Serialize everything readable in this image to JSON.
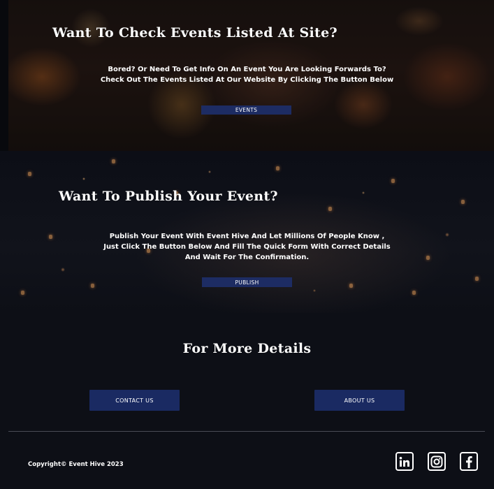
{
  "events_section": {
    "heading": "Want To Check Events Listed At Site?",
    "line1": "Bored? Or Need To Get Info On An Event You Are Looking Forwards To?",
    "line2": "Check Out The Events Listed At  Our Website By Clicking The Button Below",
    "button": "EVENTS"
  },
  "publish_section": {
    "heading": "Want To Publish Your Event?",
    "line1": "Publish Your Event With Event  Hive And Let Millions Of People Know ,",
    "line2": "Just Click The Button Below And Fill The Quick Form With Correct Details",
    "line3": "And Wait For The Confirmation.",
    "button": "PUBLISH"
  },
  "details_section": {
    "heading": "For More Details",
    "contact_button": "CONTACT  US",
    "about_button": "ABOUT US"
  },
  "footer": {
    "copyright": "Copyright© Event Hive 2023",
    "social_icons": [
      "linkedin-icon",
      "instagram-icon",
      "facebook-icon"
    ]
  }
}
